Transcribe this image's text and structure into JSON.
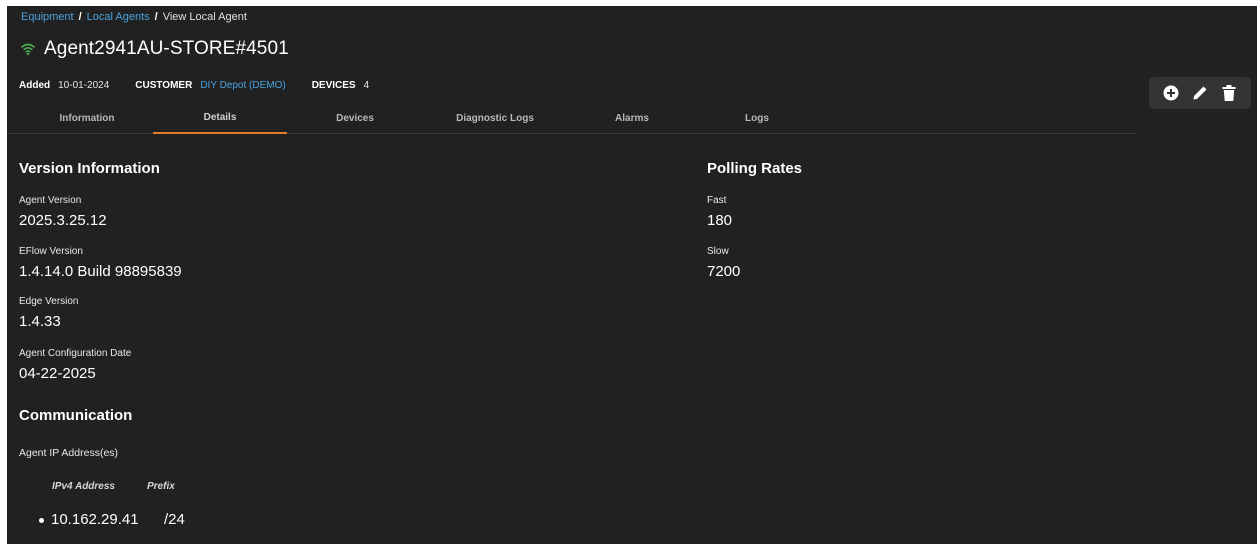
{
  "breadcrumb": {
    "items": [
      {
        "label": "Equipment",
        "link": true
      },
      {
        "label": "Local Agents",
        "link": true
      },
      {
        "label": "View Local Agent",
        "link": false
      }
    ],
    "separator": "/"
  },
  "agent": {
    "name": "Agent2941AU-STORE#4501",
    "status_icon": "wifi-icon",
    "status_color": "#4caf50"
  },
  "meta": {
    "added_label": "Added",
    "added_value": "10-01-2024",
    "customer_label": "CUSTOMER",
    "customer_value": "DIY Depot (DEMO)",
    "devices_label": "DEVICES",
    "devices_value": "4"
  },
  "actions": {
    "add_icon": "plus-circle-icon",
    "edit_icon": "pencil-icon",
    "delete_icon": "trash-icon"
  },
  "tabs": [
    {
      "label": "Information",
      "active": false
    },
    {
      "label": "Details",
      "active": true
    },
    {
      "label": "Devices",
      "active": false
    },
    {
      "label": "Diagnostic Logs",
      "active": false
    },
    {
      "label": "Alarms",
      "active": false
    },
    {
      "label": "Logs",
      "active": false
    }
  ],
  "version_info": {
    "title": "Version Information",
    "fields": [
      {
        "label": "Agent Version",
        "value": "2025.3.25.12"
      },
      {
        "label": "EFlow Version",
        "value": "1.4.14.0 Build 98895839"
      },
      {
        "label": "Edge Version",
        "value": "1.4.33"
      },
      {
        "label": "Agent Configuration Date",
        "value": "04-22-2025"
      }
    ]
  },
  "polling_rates": {
    "title": "Polling Rates",
    "fields": [
      {
        "label": "Fast",
        "value": "180"
      },
      {
        "label": "Slow",
        "value": "7200"
      }
    ]
  },
  "communication": {
    "title": "Communication",
    "ip_label": "Agent IP Address(es)",
    "col_ipv4": "IPv4 Address",
    "col_prefix": "Prefix",
    "rows": [
      {
        "ip": "10.162.29.41",
        "prefix": "/24"
      }
    ]
  },
  "colors": {
    "background": "#212121",
    "accent_link": "#4aa3df",
    "active_tab_underline": "#e07b2a"
  }
}
